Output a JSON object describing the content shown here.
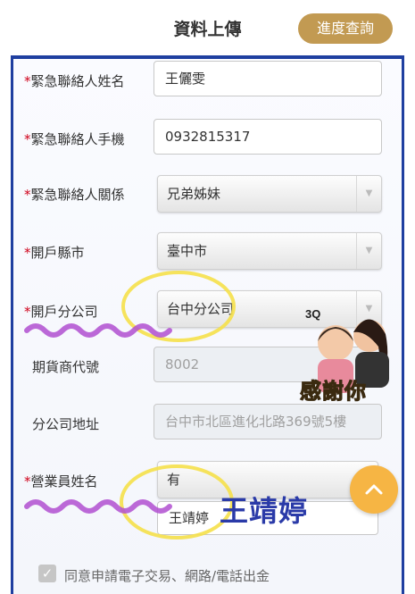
{
  "header": {
    "title": "資料上傳",
    "progress_button": "進度查詢"
  },
  "form": {
    "required_mark": "*",
    "emergency_name": {
      "label": "緊急聯絡人姓名",
      "value": "王儷雯"
    },
    "emergency_phone": {
      "label": "緊急聯絡人手機",
      "value": "0932815317"
    },
    "emergency_relation": {
      "label": "緊急聯絡人關係",
      "value": "兄弟姊妹"
    },
    "county": {
      "label": "開戶縣市",
      "value": "臺中市"
    },
    "branch": {
      "label": "開戶分公司",
      "value": "台中分公司"
    },
    "broker_code": {
      "label": "期貨商代號",
      "value": "8002"
    },
    "branch_address": {
      "label": "分公司地址",
      "value": "台中市北區進化北路369號5樓"
    },
    "salesperson": {
      "label": "營業員姓名",
      "select_value": "有",
      "input_value": "王靖婷"
    },
    "agree": {
      "label": "同意申請電子交易、網路/電話出金",
      "checked": true
    }
  },
  "overlay": {
    "sticker_badge": "3Q",
    "sticker_text": "感謝你",
    "big_name": "王靖婷"
  },
  "colors": {
    "brand_gold": "#c29a52",
    "frame_blue": "#1f3fa0",
    "required_red": "#d0021b",
    "scroll_button": "#f6b544",
    "highlight_yellow": "#f5e04a",
    "underline_purple": "#b04fd0"
  },
  "icons": {
    "select_arrow": "chevron-down-icon",
    "scroll_top": "chevron-up-icon",
    "checkbox": "check-icon"
  }
}
